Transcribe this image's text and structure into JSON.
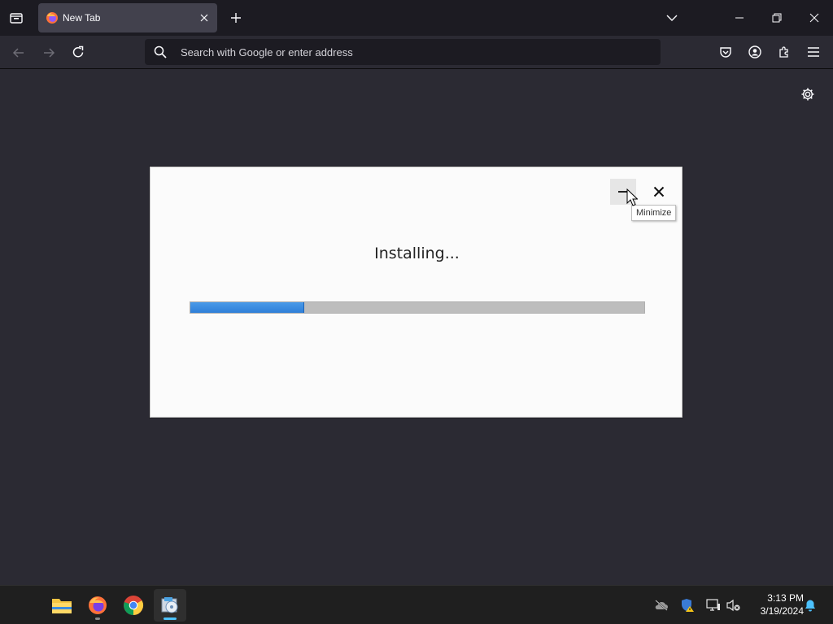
{
  "browser": {
    "tab": {
      "title": "New Tab"
    },
    "urlbar": {
      "placeholder": "Search with Google or enter address"
    }
  },
  "dialog": {
    "status_text": "Installing...",
    "tooltip": "Minimize",
    "progress_fraction": 0.25,
    "progress_color": "#3a8ae0"
  },
  "taskbar": {
    "apps": [
      "file-explorer",
      "firefox",
      "chrome",
      "installer"
    ],
    "time": "3:13 PM",
    "date": "3/19/2024"
  }
}
